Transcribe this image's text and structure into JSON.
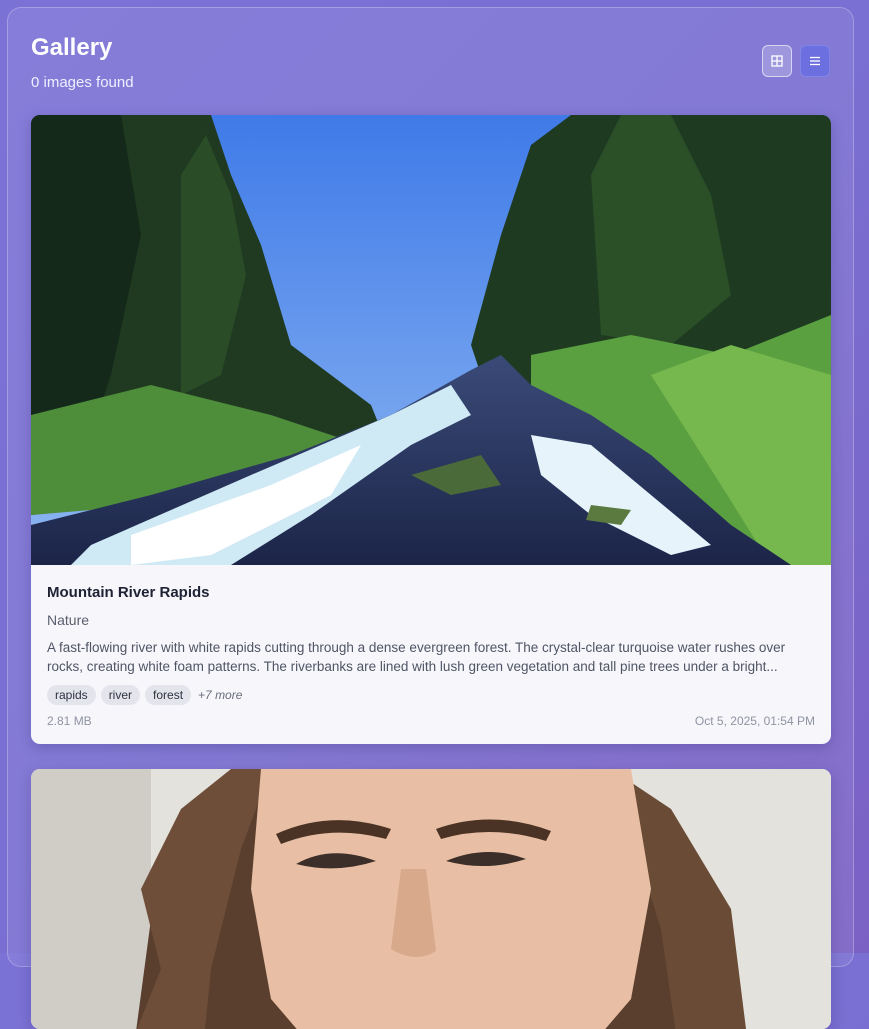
{
  "header": {
    "title": "Gallery",
    "count_text": "0 images found"
  },
  "view_toggle": {
    "grid_icon": "grid-icon",
    "list_icon": "list-icon",
    "active": "list"
  },
  "images": [
    {
      "title": "Mountain River Rapids",
      "category": "Nature",
      "description": "A fast-flowing river with white rapids cutting through a dense evergreen forest. The crystal-clear turquoise water rushes over rocks, creating white foam patterns. The riverbanks are lined with lush green vegetation and tall pine trees under a bright...",
      "tags": [
        "rapids",
        "river",
        "forest"
      ],
      "more_tags": "+7 more",
      "size": "2.81 MB",
      "date": "Oct 5, 2025, 01:54 PM"
    },
    {
      "title": "",
      "category": "",
      "description": "",
      "tags": [],
      "more_tags": "",
      "size": "",
      "date": ""
    }
  ],
  "colors": {
    "background": "#7b6fd3",
    "card": "#f6f6fb",
    "active_button": "#6c6fe0"
  }
}
